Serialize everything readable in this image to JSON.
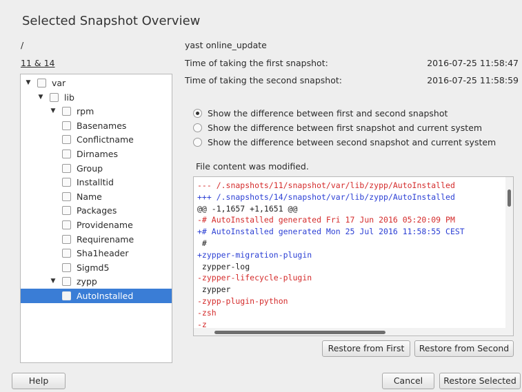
{
  "dialog": {
    "title": "Selected Snapshot Overview"
  },
  "left": {
    "path": "/",
    "snapshots": "11 & 14"
  },
  "tree": [
    {
      "label": "var",
      "expanded": true,
      "depth": 0,
      "selected": false
    },
    {
      "label": "lib",
      "expanded": true,
      "depth": 1,
      "selected": false
    },
    {
      "label": "rpm",
      "expanded": true,
      "depth": 2,
      "selected": false
    },
    {
      "label": "Basenames",
      "depth": 3,
      "selected": false
    },
    {
      "label": "Conflictname",
      "depth": 3,
      "selected": false
    },
    {
      "label": "Dirnames",
      "depth": 3,
      "selected": false
    },
    {
      "label": "Group",
      "depth": 3,
      "selected": false
    },
    {
      "label": "Installtid",
      "depth": 3,
      "selected": false
    },
    {
      "label": "Name",
      "depth": 3,
      "selected": false
    },
    {
      "label": "Packages",
      "depth": 3,
      "selected": false
    },
    {
      "label": "Providename",
      "depth": 3,
      "selected": false
    },
    {
      "label": "Requirename",
      "depth": 3,
      "selected": false
    },
    {
      "label": "Sha1header",
      "depth": 3,
      "selected": false
    },
    {
      "label": "Sigmd5",
      "depth": 3,
      "selected": false
    },
    {
      "label": "zypp",
      "expanded": true,
      "depth": 2,
      "selected": false
    },
    {
      "label": "AutoInstalled",
      "depth": 3,
      "selected": true
    }
  ],
  "info": {
    "command": "yast online_update",
    "first_label": "Time of taking the first snapshot:",
    "first_value": "2016-07-25 11:58:47",
    "second_label": "Time of taking the second snapshot:",
    "second_value": "2016-07-25 11:58:59"
  },
  "options": [
    {
      "label": "Show the difference between first and second snapshot",
      "checked": true
    },
    {
      "label": "Show the difference between first snapshot and current system",
      "checked": false
    },
    {
      "label": "Show the difference between second snapshot and current system",
      "checked": false
    }
  ],
  "status": "File content was modified.",
  "diff_colors": {
    "del": "#d42b2b",
    "add": "#2b3fd4",
    "ctx": "#222222"
  },
  "diff": [
    {
      "kind": "del",
      "text": "--- /.snapshots/11/snapshot/var/lib/zypp/AutoInstalled"
    },
    {
      "kind": "add",
      "text": "+++ /.snapshots/14/snapshot/var/lib/zypp/AutoInstalled"
    },
    {
      "kind": "ctx",
      "text": "@@ -1,1657 +1,1651 @@"
    },
    {
      "kind": "del",
      "text": "-# AutoInstalled generated Fri 17 Jun 2016 05:20:09 PM"
    },
    {
      "kind": "add",
      "text": "+# AutoInstalled generated Mon 25 Jul 2016 11:58:55 CEST"
    },
    {
      "kind": "ctx",
      "text": " #"
    },
    {
      "kind": "add",
      "text": "+zypper-migration-plugin"
    },
    {
      "kind": "ctx",
      "text": " zypper-log"
    },
    {
      "kind": "del",
      "text": "-zypper-lifecycle-plugin"
    },
    {
      "kind": "ctx",
      "text": " zypper"
    },
    {
      "kind": "del",
      "text": "-zypp-plugin-python"
    },
    {
      "kind": "del",
      "text": "-zsh"
    },
    {
      "kind": "del",
      "text": "-z"
    }
  ],
  "buttons": {
    "restore_first": "Restore from First",
    "restore_second": "Restore from Second",
    "help": "Help",
    "cancel": "Cancel",
    "restore_selected": "Restore Selected"
  }
}
